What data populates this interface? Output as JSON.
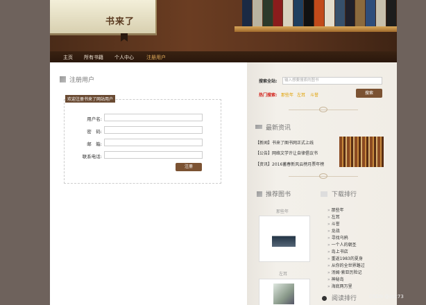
{
  "brand": {
    "title": "书来了"
  },
  "nav": {
    "items": [
      "主页",
      "所有书籍",
      "个人中心",
      "注册用户"
    ]
  },
  "register": {
    "title": "注册用户",
    "legend": "欢迎注册书来了网站用户",
    "fields": [
      "用户名:",
      "密　码:",
      "邮　箱:",
      "联系电话:"
    ],
    "submit_label": "注册"
  },
  "search": {
    "label": "搜索全站:",
    "placeholder": "输入想要搜索的图书",
    "hot_label": "热门搜索:",
    "hot_items": [
      "那些年",
      "左耳",
      "斗誉"
    ],
    "button": "搜索"
  },
  "news": {
    "title": "最新资讯",
    "items": [
      "【新闻】书来了图书网正式上线",
      "【公告】网络文学许让自律倡议书",
      "【资讯】2016蓄春新风云榜月票年榜"
    ]
  },
  "recommend": {
    "title": "推荐图书",
    "books": [
      {
        "caption": "那些年"
      },
      {
        "caption": "左耳"
      }
    ]
  },
  "downloads": {
    "title": "下载排行",
    "items": [
      "那些年",
      "左耳",
      "斗誉",
      "龙战",
      "寻找乌鸦",
      "一个人的朝圣",
      "岛上书店",
      "重返1983的夏身",
      "从你的全世界路过",
      "汤姆·索亚历险记",
      "神秘岛",
      "海底两万里"
    ]
  },
  "reading": {
    "title": "阅读排行"
  },
  "watermark": "CSDN @ss273",
  "colors": {
    "accent": "#7b5232",
    "hot_red": "#d2231c",
    "hot_yellow": "#e0a000"
  }
}
